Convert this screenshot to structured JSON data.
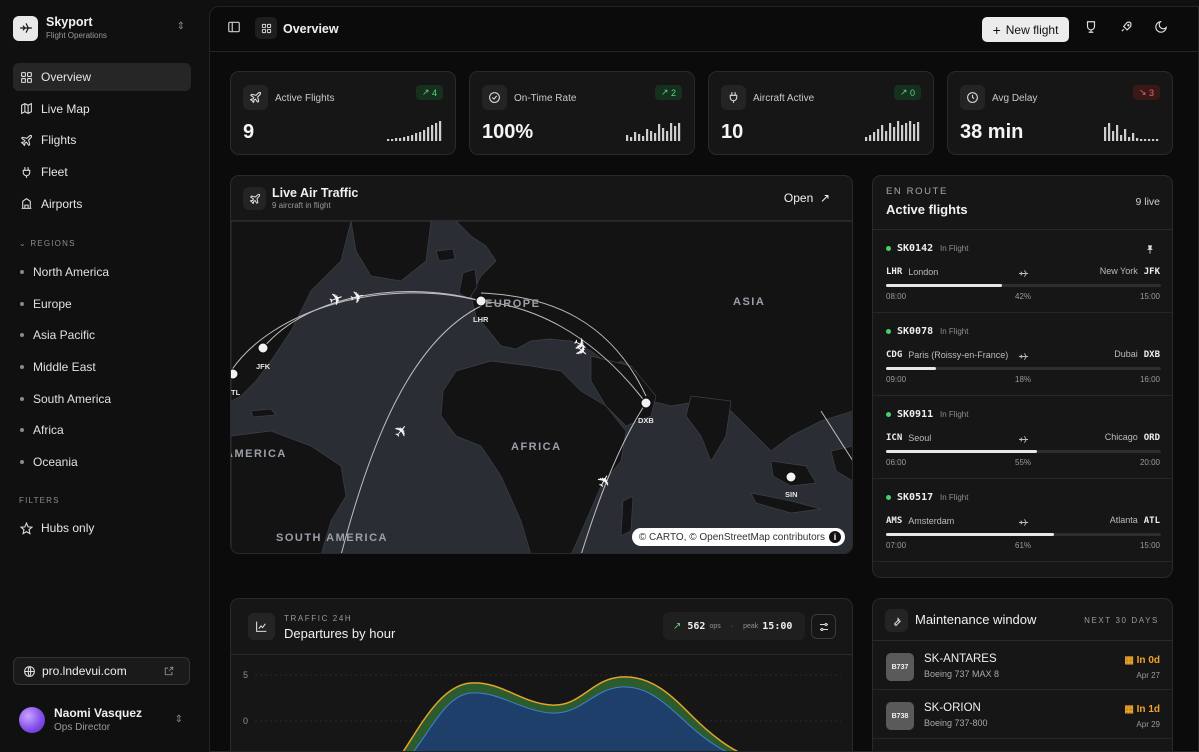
{
  "brand": {
    "name": "Skyport",
    "subtitle": "Flight Operations"
  },
  "nav": [
    {
      "label": "Overview",
      "icon": "grid-icon",
      "active": true
    },
    {
      "label": "Live Map",
      "icon": "map-icon"
    },
    {
      "label": "Flights",
      "icon": "plane-icon"
    },
    {
      "label": "Fleet",
      "icon": "plug-icon"
    },
    {
      "label": "Airports",
      "icon": "building-icon"
    }
  ],
  "regions": {
    "label": "REGIONS",
    "items": [
      "North America",
      "Europe",
      "Asia Pacific",
      "Middle East",
      "South America",
      "Africa",
      "Oceania"
    ]
  },
  "filters": {
    "label": "FILTERS",
    "hubs_only": "Hubs only"
  },
  "domain": "pro.lndevui.com",
  "user": {
    "name": "Naomi Vasquez",
    "role": "Ops Director"
  },
  "topbar": {
    "breadcrumb": "Overview",
    "new_flight": "New flight"
  },
  "stats": [
    {
      "label": "Active Flights",
      "value": "9",
      "delta": "4",
      "trend": "up",
      "icon": "plane-icon"
    },
    {
      "label": "On-Time Rate",
      "value": "100%",
      "delta": "2",
      "trend": "up",
      "icon": "check-circle-icon"
    },
    {
      "label": "Aircraft Active",
      "value": "10",
      "delta": "0",
      "trend": "up",
      "icon": "plug-icon"
    },
    {
      "label": "Avg Delay",
      "value": "38 min",
      "delta": "3",
      "trend": "down",
      "icon": "clock-icon"
    }
  ],
  "traffic": {
    "title": "Live Air Traffic",
    "subtitle": "9 aircraft in flight",
    "open": "Open",
    "attribution": "© CARTO, © OpenStreetMap contributors",
    "regions": {
      "europe": "EUROPE",
      "asia": "ASIA",
      "africa": "AFRICA",
      "america": "AMERICA",
      "south_america": "SOUTH AMERICA"
    },
    "airports": {
      "lhr": "LHR",
      "jfk": "JFK",
      "dxb": "DXB",
      "sin": "SIN",
      "atl": "TL"
    }
  },
  "active_flights": {
    "eyebrow": "EN ROUTE",
    "title": "Active flights",
    "live": "9 live",
    "items": [
      {
        "id": "SK0142",
        "status": "In Flight",
        "from": "LHR",
        "from_city": "London",
        "to": "JFK",
        "to_city": "New York",
        "dep": "08:00",
        "arr": "15:00",
        "progress_label": "42%",
        "progress": 0.42,
        "pinned": true
      },
      {
        "id": "SK0078",
        "status": "In Flight",
        "from": "CDG",
        "from_city": "Paris (Roissy-en-France)",
        "to": "DXB",
        "to_city": "Dubai",
        "dep": "09:00",
        "arr": "16:00",
        "progress_label": "18%",
        "progress": 0.18
      },
      {
        "id": "SK0911",
        "status": "In Flight",
        "from": "ICN",
        "from_city": "Seoul",
        "to": "ORD",
        "to_city": "Chicago",
        "dep": "06:00",
        "arr": "20:00",
        "progress_label": "55%",
        "progress": 0.55
      },
      {
        "id": "SK0517",
        "status": "In Flight",
        "from": "AMS",
        "from_city": "Amsterdam",
        "to": "ATL",
        "to_city": "Atlanta",
        "dep": "07:00",
        "arr": "15:00",
        "progress_label": "61%",
        "progress": 0.61
      }
    ]
  },
  "departures": {
    "eyebrow": "TRAFFIC 24H",
    "title": "Departures by hour",
    "ops": "562",
    "ops_label": "ops",
    "sep": "·",
    "peak_label": "peak",
    "peak": "15:00",
    "y_ticks": [
      "5",
      "0"
    ]
  },
  "maintenance": {
    "title": "Maintenance window",
    "next": "NEXT 30 DAYS",
    "items": [
      {
        "code": "B737",
        "name": "SK-ANTARES",
        "model": "Boeing 737 MAX 8",
        "due": "In 0d",
        "date": "Apr 27"
      },
      {
        "code": "B738",
        "name": "SK-ORION",
        "model": "Boeing 737-800",
        "due": "In 1d",
        "date": "Apr 29"
      }
    ]
  },
  "colors": {
    "accent_green": "#44d06a",
    "delay_red": "#e86a6a",
    "warning": "#f0a42a"
  }
}
